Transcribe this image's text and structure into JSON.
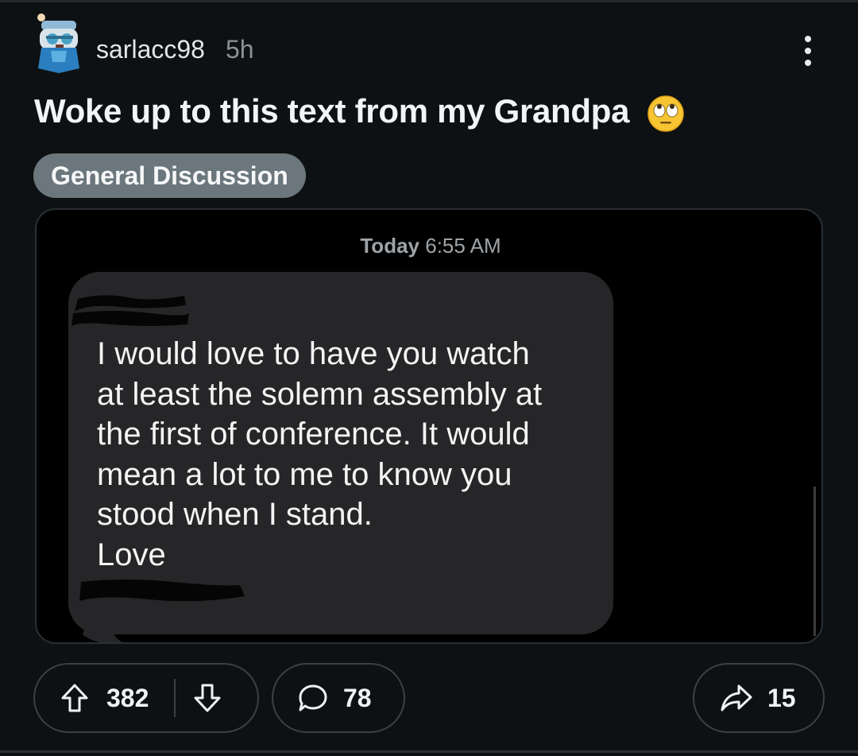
{
  "post": {
    "username": "sarlacc98",
    "time": "5h",
    "title": "Woke up to this text from my Grandpa",
    "title_emoji_icon": "face-with-rolling-eyes-icon",
    "flair": "General Discussion"
  },
  "message": {
    "day": "Today",
    "time": "6:55 AM",
    "body": "I would love to have you watch\nat least the solemn assembly at\nthe first of conference. It would\nmean a lot to me to know you\nstood when I stand.\nLove"
  },
  "actions": {
    "upvotes": "382",
    "comments": "78",
    "shares": "15"
  },
  "icons": {
    "more": "more-vertical-icon",
    "upvote": "arrow-up-icon",
    "downvote": "arrow-down-icon",
    "comment": "speech-bubble-icon",
    "share": "share-arrow-icon"
  },
  "colors": {
    "background": "#0e1113",
    "flair_background": "#6b777c",
    "bubble": "#262628",
    "muted_text": "#8a9296"
  }
}
